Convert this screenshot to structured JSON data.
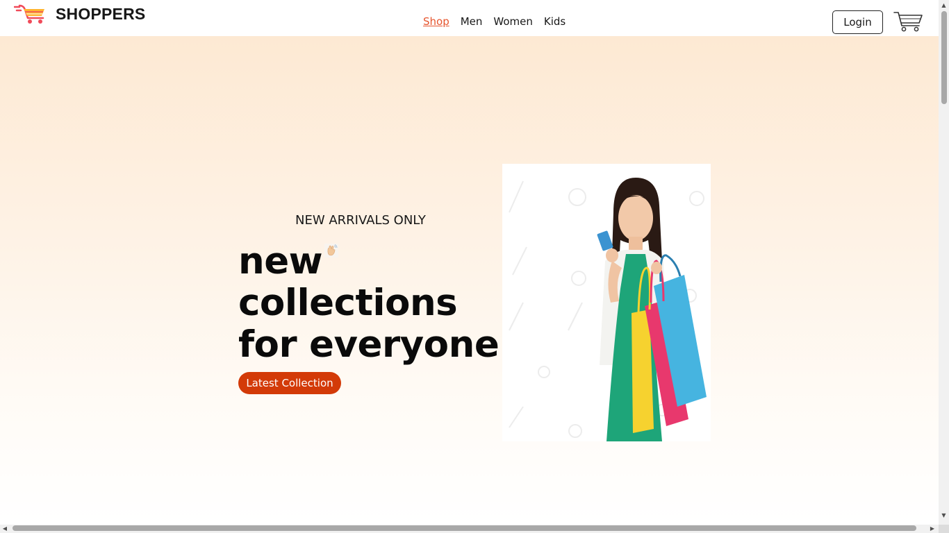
{
  "navbar": {
    "brand": "SHOPPERS",
    "menu": [
      {
        "label": "Shop",
        "active": true
      },
      {
        "label": "Men",
        "active": false
      },
      {
        "label": "Women",
        "active": false
      },
      {
        "label": "Kids",
        "active": false
      }
    ],
    "login_label": "Login",
    "cart_icon": "shopping-cart-icon",
    "logo_icon": "shopping-cart-logo-icon"
  },
  "hero": {
    "subtitle": "NEW ARRIVALS ONLY",
    "title_lines": [
      "new",
      "collections",
      "for everyone"
    ],
    "hand_icon": "waving-hand-icon",
    "cta_label": "Latest Collection",
    "image": "woman-with-shopping-bags-image"
  },
  "colors": {
    "accent": "#d33a08",
    "active_link": "#e6542d",
    "hero_gradient_top": "#fde9d3",
    "hero_gradient_bottom": "#ffffff",
    "text": "#171717"
  }
}
